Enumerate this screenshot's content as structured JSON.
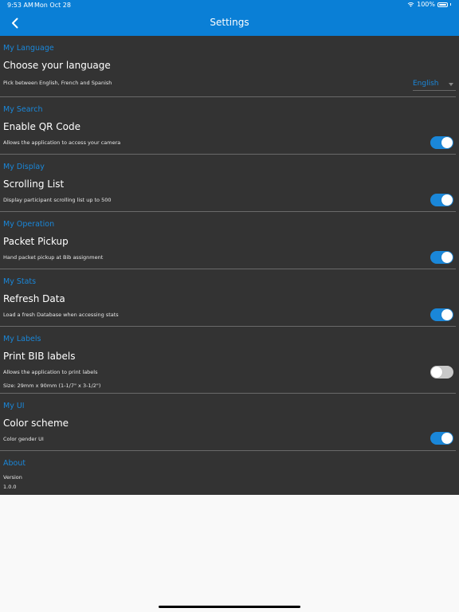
{
  "status": {
    "time": "9:53 AM",
    "date": "Mon Oct 28",
    "battery": "100%"
  },
  "header": {
    "title": "Settings"
  },
  "language": {
    "section": "My Language",
    "title": "Choose your language",
    "desc": "Pick between English, French and Spanish",
    "value": "English"
  },
  "search": {
    "section": "My Search",
    "title": "Enable QR Code",
    "desc": "Allows the application to access your camera",
    "enabled": true
  },
  "display": {
    "section": "My Display",
    "title": "Scrolling List",
    "desc": "Display participant scrolling list up to 500",
    "enabled": true
  },
  "operation": {
    "section": "My Operation",
    "title": "Packet Pickup",
    "desc": "Hand packet pickup at Bib assignment",
    "enabled": true
  },
  "stats": {
    "section": "My Stats",
    "title": "Refresh Data",
    "desc": "Load a fresh Database when accessing stats",
    "enabled": true
  },
  "labels": {
    "section": "My Labels",
    "title": "Print BIB labels",
    "desc": "Allows the application to print labels",
    "size": "Size: 29mm x 90mm (1-1/7\" x 3-1/2\")",
    "enabled": false
  },
  "ui": {
    "section": "My UI",
    "title": "Color scheme",
    "desc": "Color gender UI",
    "enabled": true
  },
  "about": {
    "section": "About",
    "version_label": "Version",
    "version": "1.0.0"
  },
  "colors": {
    "accent": "#0a7fd6",
    "panel": "#333333",
    "toggle_on": "#1a87d9",
    "toggle_off": "#c9c9c9"
  }
}
